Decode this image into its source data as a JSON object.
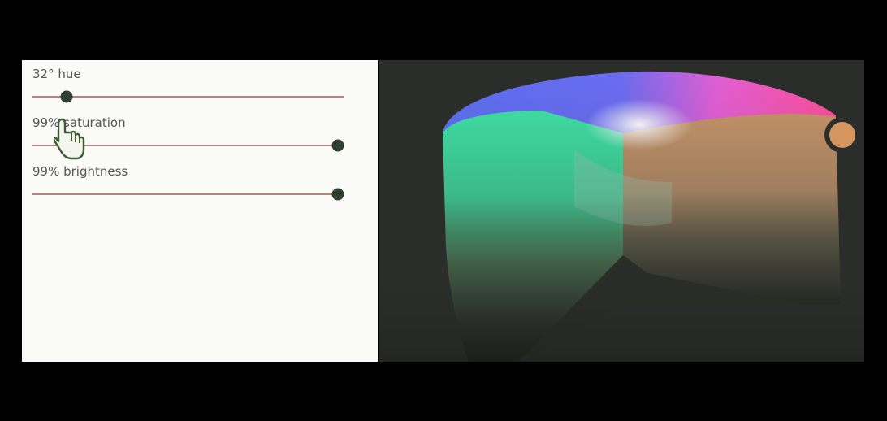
{
  "controls": {
    "hue": {
      "label": "32° hue",
      "value_deg": 32,
      "fraction": 0.11
    },
    "saturation": {
      "label": "99% saturation",
      "value_pct": 99,
      "fraction": 0.98
    },
    "brightness": {
      "label": "99% brightness",
      "value_pct": 99,
      "fraction": 0.98
    }
  },
  "colors": {
    "panel_bg": "#fafaf7",
    "track": "#b5827f",
    "thumb": "#2f4031",
    "viewport_bg": "#2b2d2a",
    "selected_color": "#d4965e"
  },
  "icons": {
    "cursor": "hand-pointer-icon",
    "marker": "selected-color-marker-icon"
  }
}
